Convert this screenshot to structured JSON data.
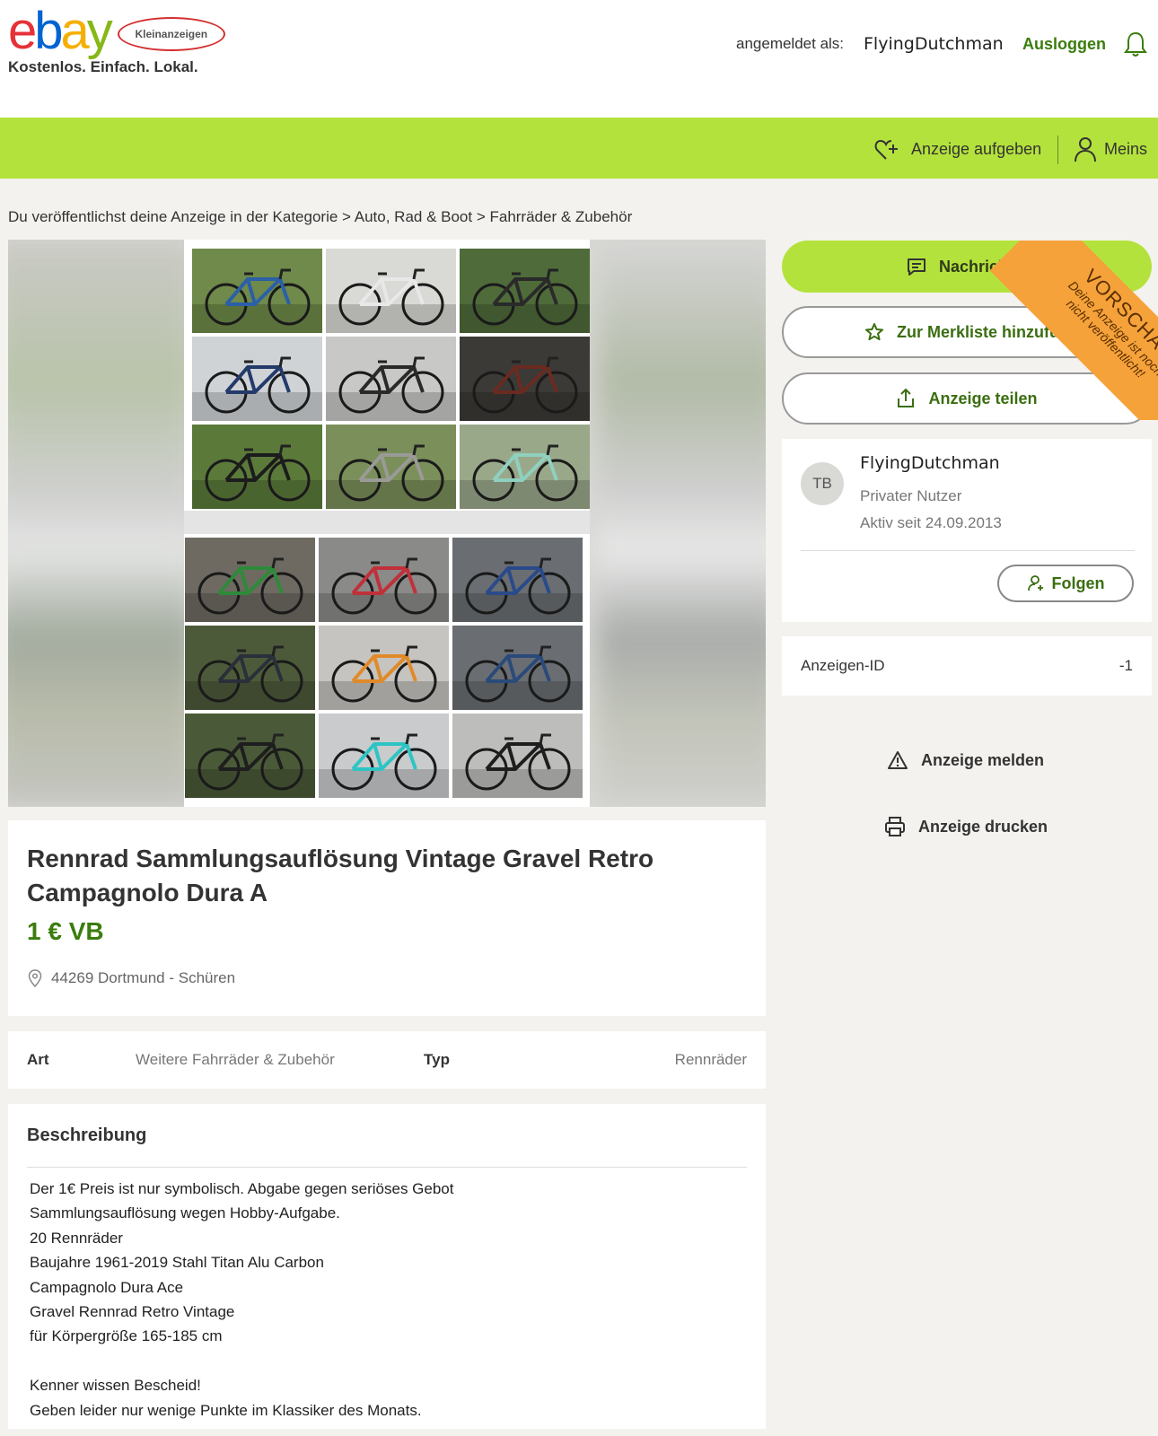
{
  "header": {
    "logo_text": "ebay",
    "logo_badge": "Kleinanzeigen",
    "tagline": "Kostenlos. Einfach. Lokal.",
    "login_label": "angemeldet als:",
    "username": "FlyingDutchman",
    "logout_label": "Ausloggen",
    "bell_icon": "bell-icon"
  },
  "navbar": {
    "post_ad_label": "Anzeige aufgeben",
    "mine_label": "Meins",
    "accent_color": "#b4e23c"
  },
  "breadcrumb": "Du veröffentlichst deine Anzeige in der Kategorie > Auto, Rad & Boot > Fahrräder & Zubehör",
  "listing": {
    "title": "Rennrad Sammlungsauflösung Vintage Gravel Retro Campagnolo Dura A",
    "price": "1 € VB",
    "location": "44269 Dortmund - Schüren",
    "price_color": "#3a7d0c"
  },
  "attributes": {
    "art_label": "Art",
    "art_value": "Weitere Fahrräder & Zubehör",
    "typ_label": "Typ",
    "typ_value": "Rennräder"
  },
  "description": {
    "heading": "Beschreibung",
    "lines": [
      "Der 1€ Preis ist nur symbolisch. Abgabe gegen seriöses Gebot",
      "Sammlungsauflösung wegen Hobby-Aufgabe.",
      "20 Rennräder",
      "Baujahre 1961-2019 Stahl Titan Alu Carbon",
      "Campagnolo Dura Ace",
      "Gravel Rennrad Retro Vintage",
      "für Körpergröße 165-185 cm",
      "",
      "Kenner wissen Bescheid!",
      "Geben leider nur wenige Punkte im Klassiker des Monats."
    ]
  },
  "actions": {
    "message_label": "Nachricht s",
    "favorite_label": "Zur Merkliste hinzufüg",
    "share_label": "Anzeige teilen",
    "report_label": "Anzeige melden",
    "print_label": "Anzeige drucken"
  },
  "preview_ribbon": {
    "title": "VORSCHAU",
    "line1": "Deine Anzeige ist noch",
    "line2": "nicht veröffentlicht!",
    "color": "#f5a23a"
  },
  "seller": {
    "initials": "TB",
    "name": "FlyingDutchman",
    "type": "Privater Nutzer",
    "active_since": "Aktiv seit 24.09.2013",
    "follow_label": "Folgen"
  },
  "ad_id": {
    "label": "Anzeigen-ID",
    "value": "-1"
  },
  "gallery": {
    "photos_top": [
      {
        "bg": "#6f8a4a",
        "frame": "#2b5fa8"
      },
      {
        "bg": "#d9d9d6",
        "frame": "#e8e8e8"
      },
      {
        "bg": "#4f6b3a",
        "frame": "#2a2a2a"
      },
      {
        "bg": "#cfd3d6",
        "frame": "#243a6b"
      },
      {
        "bg": "#c8c8c6",
        "frame": "#2a2a2a"
      },
      {
        "bg": "#3b3a36",
        "frame": "#6b2a20"
      },
      {
        "bg": "#5b7a3a",
        "frame": "#1c1c1c"
      },
      {
        "bg": "#7b8f5a",
        "frame": "#9a9a96"
      },
      {
        "bg": "#9aa88a",
        "frame": "#8fd0c0"
      }
    ],
    "photos_bottom": [
      {
        "bg": "#6e6a62",
        "frame": "#2e8a3a"
      },
      {
        "bg": "#8a8a88",
        "frame": "#c0303a"
      },
      {
        "bg": "#6a6e72",
        "frame": "#2a4a8a"
      },
      {
        "bg": "#4d5a3a",
        "frame": "#2a2f3a"
      },
      {
        "bg": "#c6c4c0",
        "frame": "#e08a2a"
      },
      {
        "bg": "#6a6e72",
        "frame": "#2a4a7a"
      },
      {
        "bg": "#4a5a38",
        "frame": "#1e1e1e"
      },
      {
        "bg": "#c9cbcc",
        "frame": "#2ec4c4"
      },
      {
        "bg": "#bdbdbb",
        "frame": "#1e1e1e"
      }
    ]
  }
}
